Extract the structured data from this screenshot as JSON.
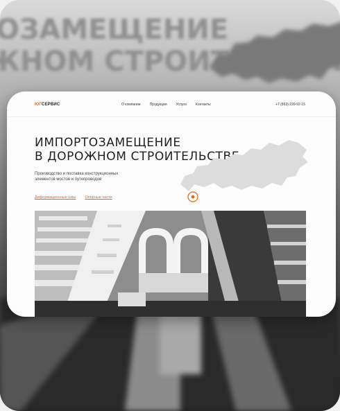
{
  "background": {
    "headline_lines": [
      "ОЗАМЕЩЕНИЕ",
      "ЖНОМ СТРОИТЕЛЬСТВЕ"
    ]
  },
  "nav": {
    "logo_accent": "ЮГ",
    "logo_rest": "СЕРВИС",
    "menu": [
      "О компании",
      "Продукция",
      "Услуги",
      "Контакты"
    ],
    "phone": "+7 (863) 220-92-15"
  },
  "hero": {
    "title_line1": "ИМПОРТОЗАМЕЩЕНИЕ",
    "title_line2": "В ДОРОЖНОМ СТРОИТЕЛЬСТВЕ",
    "subtitle_line1": "Производство и поставка конструкционных",
    "subtitle_line2": "элементов мостов и путепроводов",
    "links": [
      "Деформационные швы",
      "Опорные части"
    ]
  },
  "colors": {
    "accent": "#e06a1d",
    "text": "#1f1f1f",
    "map": "#dcdcdc"
  },
  "icons": {
    "map": "russia-map-icon",
    "location": "location-pin-icon"
  }
}
